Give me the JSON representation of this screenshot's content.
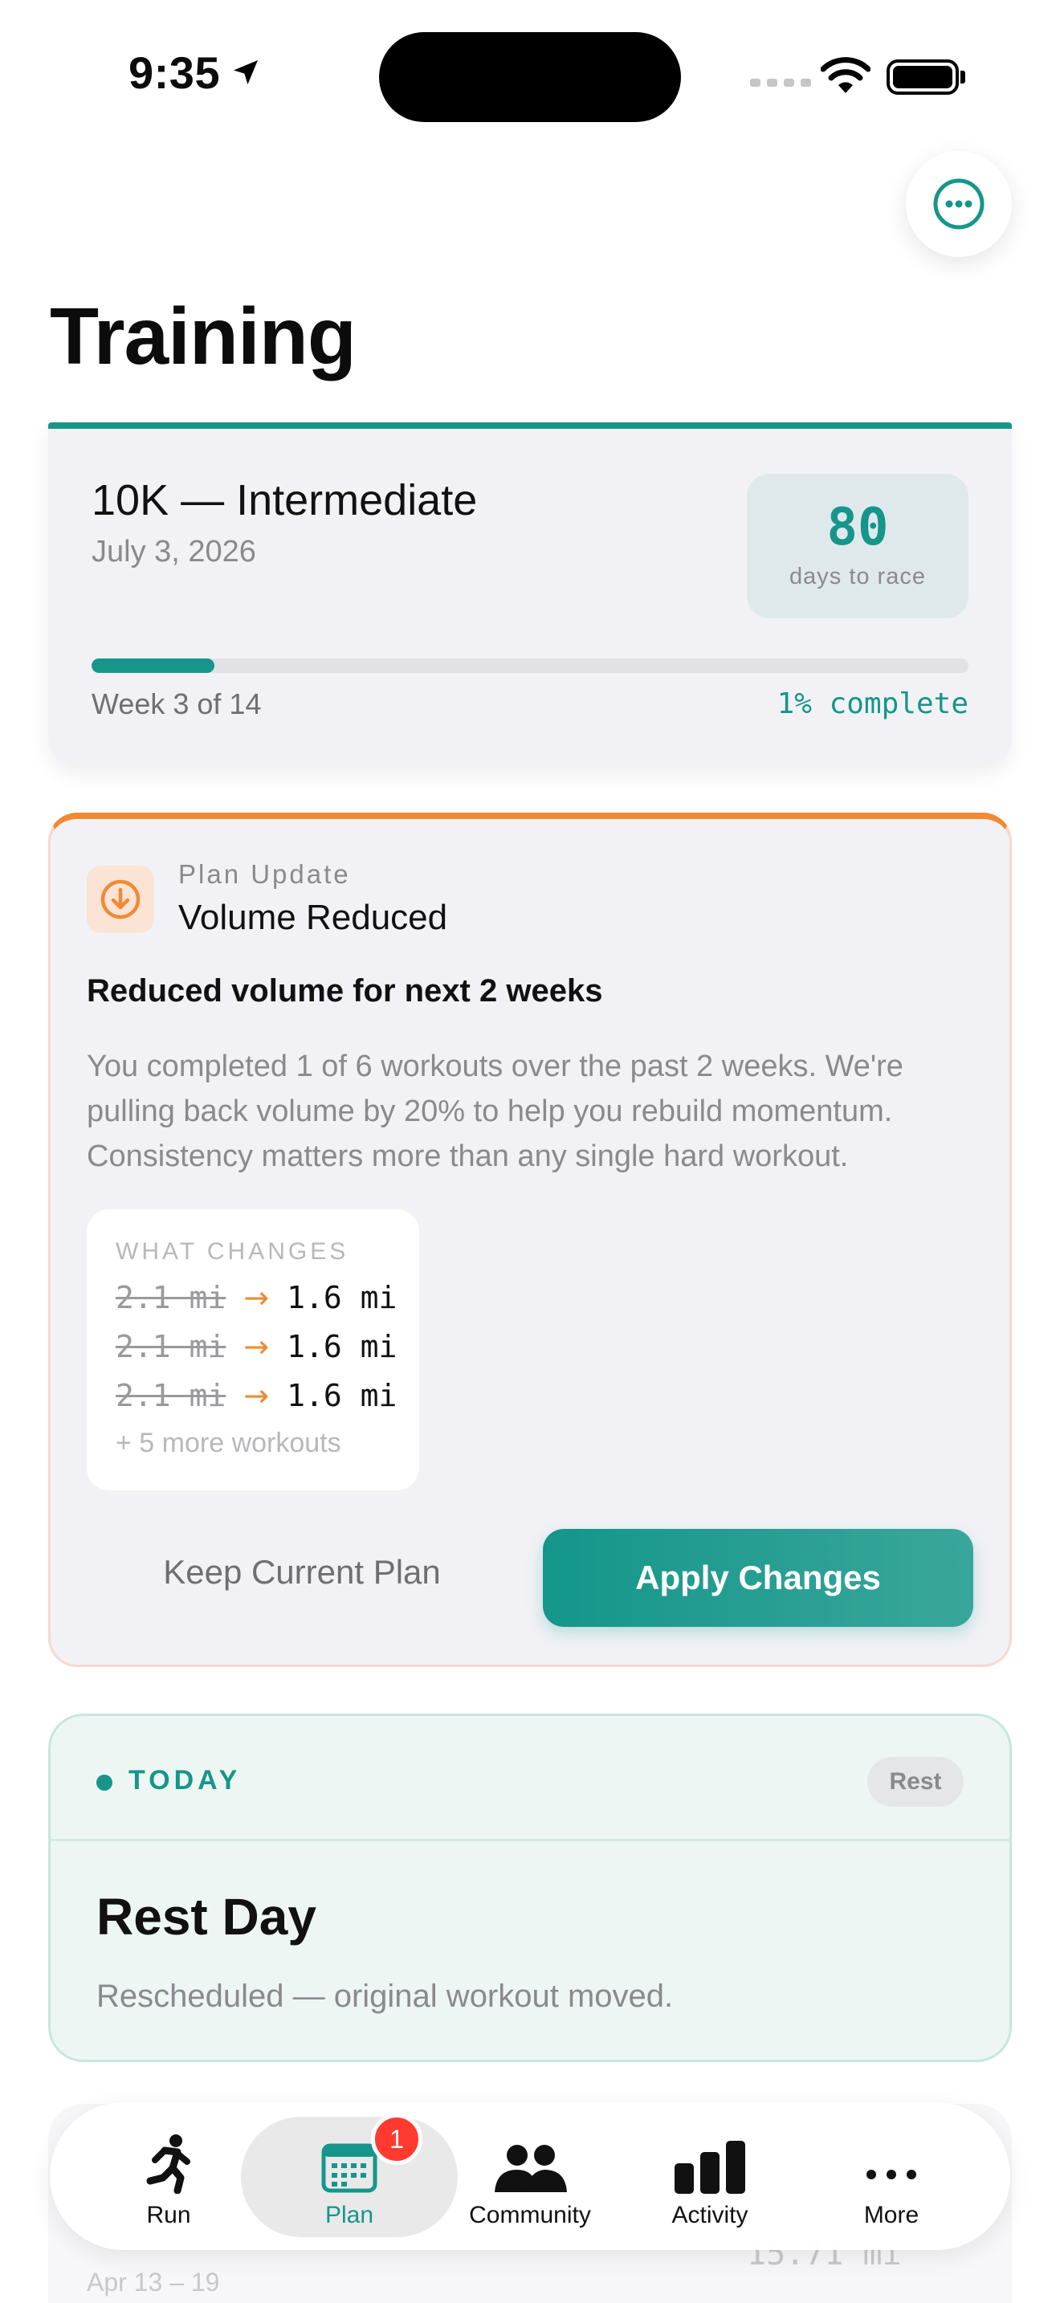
{
  "status_bar": {
    "time": "9:35"
  },
  "header": {
    "title": "Training"
  },
  "race": {
    "name": "10K — Intermediate",
    "date": "July 3, 2026",
    "days_to_race": "80",
    "days_label": "days to race",
    "week_text": "Week 3 of 14",
    "percent_text": "1% complete",
    "progress_fraction": 0.14
  },
  "plan_update": {
    "eyebrow": "Plan Update",
    "title": "Volume Reduced",
    "heading": "Reduced volume for next 2 weeks",
    "body": "You completed 1 of 6 workouts over the past 2 weeks. We're pulling back volume by 20% to help you rebuild momentum. Consistency matters more than any single hard workout.",
    "changes_label": "WHAT CHANGES",
    "changes": [
      {
        "old": "2.1 mi",
        "new": "1.6 mi"
      },
      {
        "old": "2.1 mi",
        "new": "1.6 mi"
      },
      {
        "old": "2.1 mi",
        "new": "1.6 mi"
      }
    ],
    "more_text": "+ 5 more workouts",
    "keep_label": "Keep Current Plan",
    "apply_label": "Apply Changes"
  },
  "today": {
    "label": "TODAY",
    "badge": "Rest",
    "title": "Rest Day",
    "subtitle": "Rescheduled — original workout moved."
  },
  "peek": {
    "dates": "Apr 13 – 19",
    "distance": "15.71 mi"
  },
  "tabbar": {
    "tabs": [
      {
        "label": "Run",
        "icon": "runner-icon"
      },
      {
        "label": "Plan",
        "icon": "calendar-icon",
        "badge": "1"
      },
      {
        "label": "Community",
        "icon": "people-icon"
      },
      {
        "label": "Activity",
        "icon": "bar-chart-icon"
      },
      {
        "label": "More",
        "icon": "ellipsis-icon"
      }
    ],
    "active": "Plan"
  },
  "colors": {
    "accent": "#16968a",
    "warning": "#f08a34",
    "badge": "#ff3b30"
  }
}
